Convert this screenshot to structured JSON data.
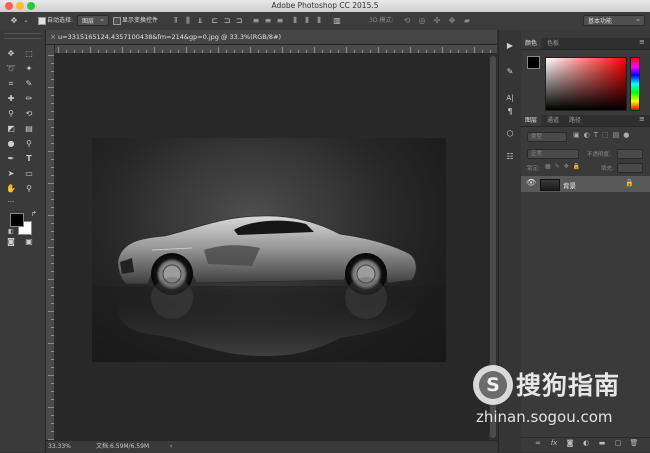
{
  "window": {
    "title": "Adobe Photoshop CC 2015.5",
    "traffic_colors": [
      "#ff5f57",
      "#febc2e",
      "#28c840"
    ]
  },
  "options_bar": {
    "move_icon": "move-tool-icon",
    "auto_select_label": "自动选择:",
    "auto_select_checked": true,
    "auto_select_target": "图层",
    "show_transform_label": "显示变换控件",
    "show_transform_checked": false,
    "mode_3d_label": "3D 模式:",
    "workspace": "基本功能"
  },
  "document": {
    "tab_label": "u=3315165124,4357100438&fm=214&gp=0.jpg @ 33.3%(RGB/8#)",
    "zoom": "33.33%",
    "doc_size": "文档:6.59M/6.59M"
  },
  "panels": {
    "color_tabs": [
      "颜色",
      "色板"
    ],
    "layers_tabs": [
      "图层",
      "通道",
      "路径"
    ],
    "kind_placeholder": "类型",
    "blend_mode": "正常",
    "opacity_label": "不透明度:",
    "lock_label": "锁定:",
    "fill_label": "填充:",
    "layer_name": "背景"
  },
  "watermark": {
    "brand": "搜狗指南",
    "url": "zhinan.sogou.com",
    "logo_letter": "S"
  },
  "colors": {
    "foreground": "#000000",
    "background": "#ffffff",
    "accent_red": "#ff0000"
  }
}
